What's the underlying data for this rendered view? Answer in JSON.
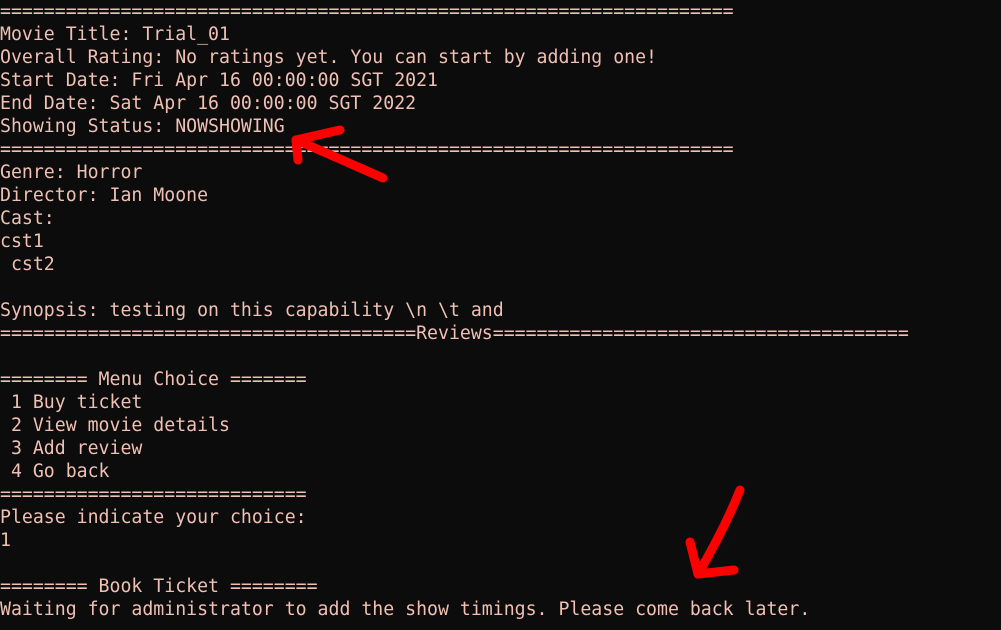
{
  "console": {
    "lines": [
      "===================================================================",
      "Movie Title: Trial_01",
      "Overall Rating: No ratings yet. You can start by adding one!",
      "Start Date: Fri Apr 16 00:00:00 SGT 2021",
      "End Date: Sat Apr 16 00:00:00 SGT 2022",
      "Showing Status: NOWSHOWING",
      "===================================================================",
      "Genre: Horror",
      "Director: Ian Moone",
      "Cast:",
      "cst1",
      " cst2",
      "",
      "Synopsis: testing on this capability \\n \\t and",
      "======================================Reviews======================================",
      "",
      "======== Menu Choice =======",
      " 1 Buy ticket",
      " 2 View movie details",
      " 3 Add review",
      " 4 Go back",
      "============================",
      "Please indicate your choice:",
      "1",
      "",
      "======== Book Ticket ========",
      "Waiting for administrator to add the show timings. Please come back later."
    ]
  },
  "colors": {
    "background": "#0c0c0c",
    "text": "#f0c0b4",
    "annotation": "#ff0000"
  }
}
